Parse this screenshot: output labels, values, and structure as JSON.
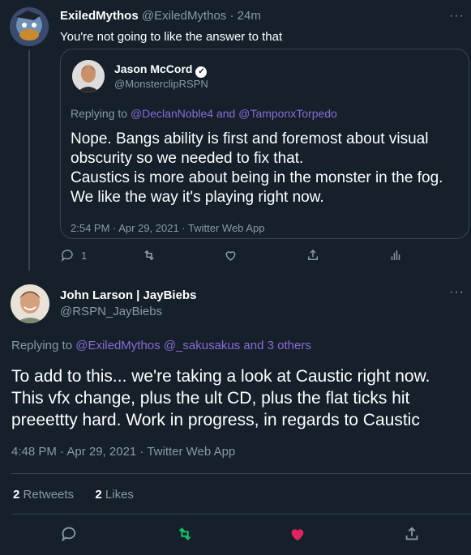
{
  "reply_tweet": {
    "display_name": "ExiledMythos",
    "handle": "@ExiledMythos",
    "separator": "·",
    "time": "24m",
    "text": "You're not going to like the answer to that",
    "reply_count": "1",
    "quoted": {
      "display_name": "Jason McCord",
      "handle": "@MonsterclipRSPN",
      "replying_prefix": "Replying to",
      "replying_users": "@DeclanNoble4 and @TamponxTorpedo",
      "body_lines": [
        "Nope. Bangs ability is first and foremost about visual",
        "obscurity so we needed to fix that.",
        "Caustics is more about being in the monster in the fog.",
        "We like the way it's playing right now."
      ],
      "meta": "2:54 PM · Apr 29, 2021 · Twitter Web App"
    }
  },
  "main_tweet": {
    "display_name": "John Larson | JayBiebs",
    "handle": "@RSPN_JayBiebs",
    "replying_prefix": "Replying to",
    "replying_users": "@ExiledMythos @_sakusakus and 3 others",
    "body_lines": [
      "To add to this... we're taking a look at Caustic right now.",
      "This vfx change, plus the ult CD, plus the flat ticks hit",
      "preeettty hard. Work in progress, in regards to Caustic"
    ],
    "meta": "4:48 PM · Apr 29, 2021 · Twitter Web App",
    "retweets_count": "2",
    "retweets_label": "Retweets",
    "likes_count": "2",
    "likes_label": "Likes"
  },
  "icons": {
    "more": "more-icon",
    "reply": "reply-icon",
    "retweet": "retweet-icon",
    "like": "like-icon",
    "share": "share-icon",
    "analytics": "analytics-icon",
    "verified": "verified-icon"
  },
  "colors": {
    "background": "#15202b",
    "muted": "#8899a6",
    "link": "#8b6bd6",
    "border": "#38444d",
    "retweet_active": "#17bf63",
    "like_active": "#e0245e"
  }
}
